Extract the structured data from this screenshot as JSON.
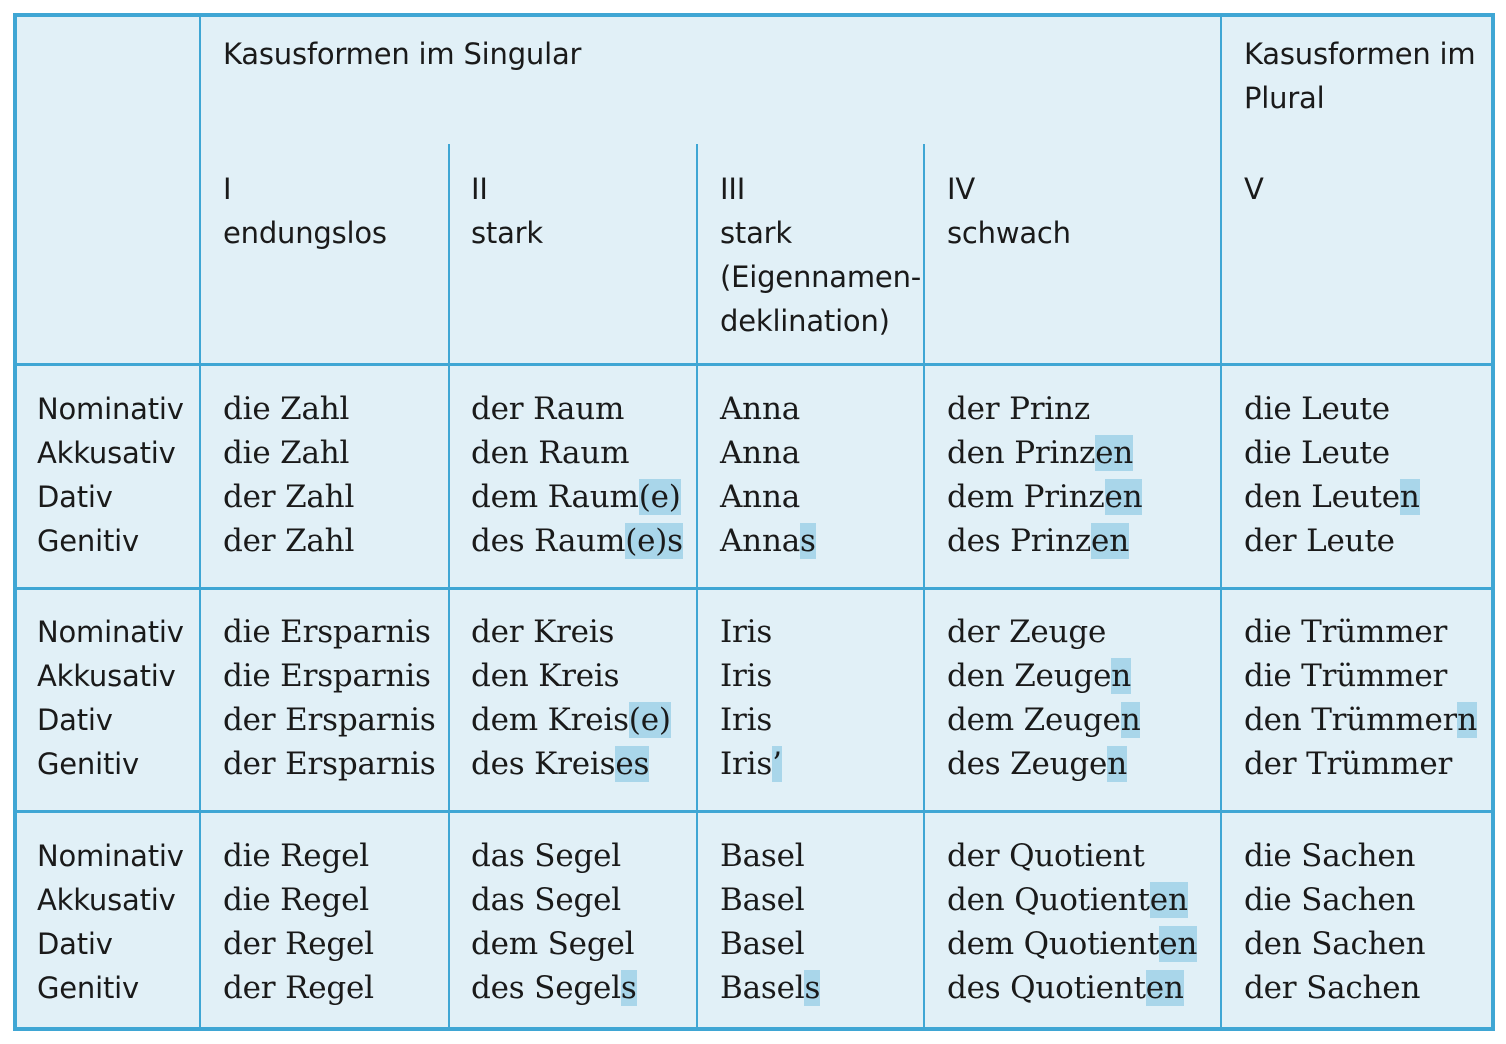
{
  "header": {
    "singular_title": "Kasusformen im Singular",
    "plural_title_line1": "Kasusformen im",
    "plural_title_line2": "Plural",
    "columns": [
      {
        "numeral": "I",
        "lines": [
          "endungslos"
        ]
      },
      {
        "numeral": "II",
        "lines": [
          "stark"
        ]
      },
      {
        "numeral": "III",
        "lines": [
          "stark",
          "(Eigennamen-",
          "deklination)"
        ]
      },
      {
        "numeral": "IV",
        "lines": [
          "schwach"
        ]
      },
      {
        "numeral": "V",
        "lines": []
      }
    ]
  },
  "cases": [
    "Nominativ",
    "Akkusativ",
    "Dativ",
    "Genitiv"
  ],
  "groups": [
    {
      "cells": [
        [
          {
            "t": "die Zahl"
          },
          {
            "t": "die Zahl"
          },
          {
            "t": "der Zahl"
          },
          {
            "t": "der Zahl"
          }
        ],
        [
          {
            "t": "der Raum"
          },
          {
            "t": "den Raum"
          },
          {
            "t": "dem Raum",
            "h": "(e)"
          },
          {
            "t": "des Raum",
            "h": "(e)s"
          }
        ],
        [
          {
            "t": "Anna"
          },
          {
            "t": "Anna"
          },
          {
            "t": "Anna"
          },
          {
            "t": "Anna",
            "h": "s"
          }
        ],
        [
          {
            "t": "der Prinz"
          },
          {
            "t": "den Prinz",
            "h": "en"
          },
          {
            "t": "dem Prinz",
            "h": "en"
          },
          {
            "t": "des Prinz",
            "h": "en"
          }
        ],
        [
          {
            "t": "die Leute"
          },
          {
            "t": "die Leute"
          },
          {
            "t": "den Leute",
            "h": "n"
          },
          {
            "t": "der Leute"
          }
        ]
      ]
    },
    {
      "cells": [
        [
          {
            "t": "die Ersparnis"
          },
          {
            "t": "die Ersparnis"
          },
          {
            "t": "der Ersparnis"
          },
          {
            "t": "der Ersparnis"
          }
        ],
        [
          {
            "t": "der Kreis"
          },
          {
            "t": "den Kreis"
          },
          {
            "t": "dem Kreis",
            "h": "(e)"
          },
          {
            "t": "des Kreis",
            "h": "es"
          }
        ],
        [
          {
            "t": "Iris"
          },
          {
            "t": "Iris"
          },
          {
            "t": "Iris"
          },
          {
            "t": "Iris",
            "h": "’"
          }
        ],
        [
          {
            "t": "der Zeuge"
          },
          {
            "t": "den Zeuge",
            "h": "n"
          },
          {
            "t": "dem Zeuge",
            "h": "n"
          },
          {
            "t": "des Zeuge",
            "h": "n"
          }
        ],
        [
          {
            "t": "die Trümmer"
          },
          {
            "t": "die Trümmer"
          },
          {
            "t": "den Trümmer",
            "h": "n"
          },
          {
            "t": "der Trümmer"
          }
        ]
      ]
    },
    {
      "cells": [
        [
          {
            "t": "die Regel"
          },
          {
            "t": "die Regel"
          },
          {
            "t": "der Regel"
          },
          {
            "t": "der Regel"
          }
        ],
        [
          {
            "t": "das Segel"
          },
          {
            "t": "das Segel"
          },
          {
            "t": "dem Segel"
          },
          {
            "t": "des Segel",
            "h": "s"
          }
        ],
        [
          {
            "t": "Basel"
          },
          {
            "t": "Basel"
          },
          {
            "t": "Basel"
          },
          {
            "t": "Basel",
            "h": "s"
          }
        ],
        [
          {
            "t": "der Quotient"
          },
          {
            "t": "den Quotient",
            "h": "en"
          },
          {
            "t": "dem Quotient",
            "h": "en"
          },
          {
            "t": "des Quotient",
            "h": "en"
          }
        ],
        [
          {
            "t": "die Sachen"
          },
          {
            "t": "die Sachen"
          },
          {
            "t": "den Sachen"
          },
          {
            "t": "der Sachen"
          }
        ]
      ]
    }
  ],
  "colors": {
    "background": "#e1f0f7",
    "rule": "#3fa6d4",
    "ending_highlight": "#a9d6ea"
  }
}
